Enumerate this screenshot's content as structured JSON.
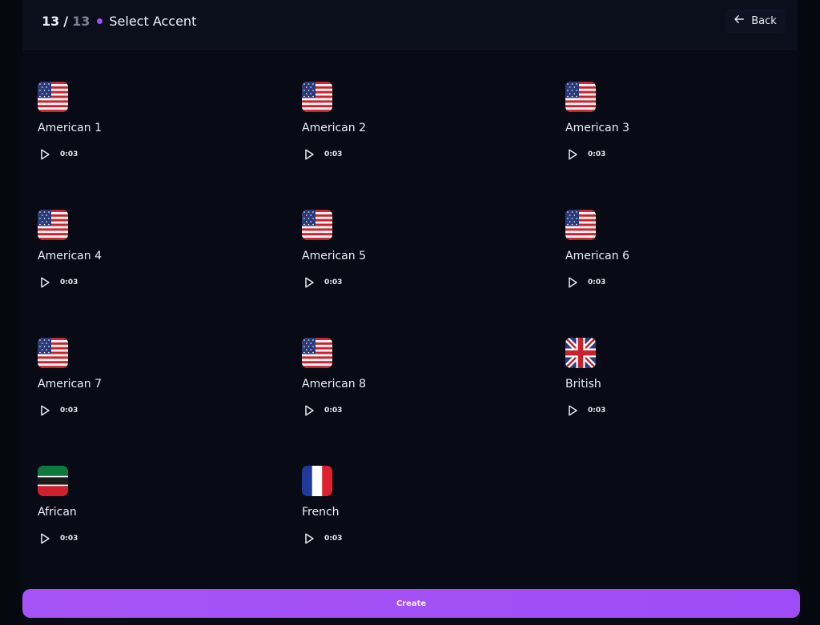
{
  "header": {
    "step_current": "13",
    "step_separator": "/",
    "step_total": "13",
    "title": "Select Accent",
    "back_label": "Back",
    "accent_color": "#a24ff5"
  },
  "accents": [
    {
      "name": "American 1",
      "flag": "us-flag-icon",
      "duration": "0:03"
    },
    {
      "name": "American 2",
      "flag": "us-flag-icon",
      "duration": "0:03"
    },
    {
      "name": "American 3",
      "flag": "us-flag-icon",
      "duration": "0:03"
    },
    {
      "name": "American 4",
      "flag": "us-flag-icon",
      "duration": "0:03"
    },
    {
      "name": "American 5",
      "flag": "us-flag-icon",
      "duration": "0:03"
    },
    {
      "name": "American 6",
      "flag": "us-flag-icon",
      "duration": "0:03"
    },
    {
      "name": "American 7",
      "flag": "us-flag-icon",
      "duration": "0:03"
    },
    {
      "name": "American 8",
      "flag": "us-flag-icon",
      "duration": "0:03"
    },
    {
      "name": "British",
      "flag": "uk-flag-icon",
      "duration": "0:03"
    },
    {
      "name": "African",
      "flag": "african-flag-icon",
      "duration": "0:03"
    },
    {
      "name": "French",
      "flag": "french-flag-icon",
      "duration": "0:03"
    }
  ],
  "footer": {
    "create_label": "Create",
    "button_color": "#a653f7"
  }
}
